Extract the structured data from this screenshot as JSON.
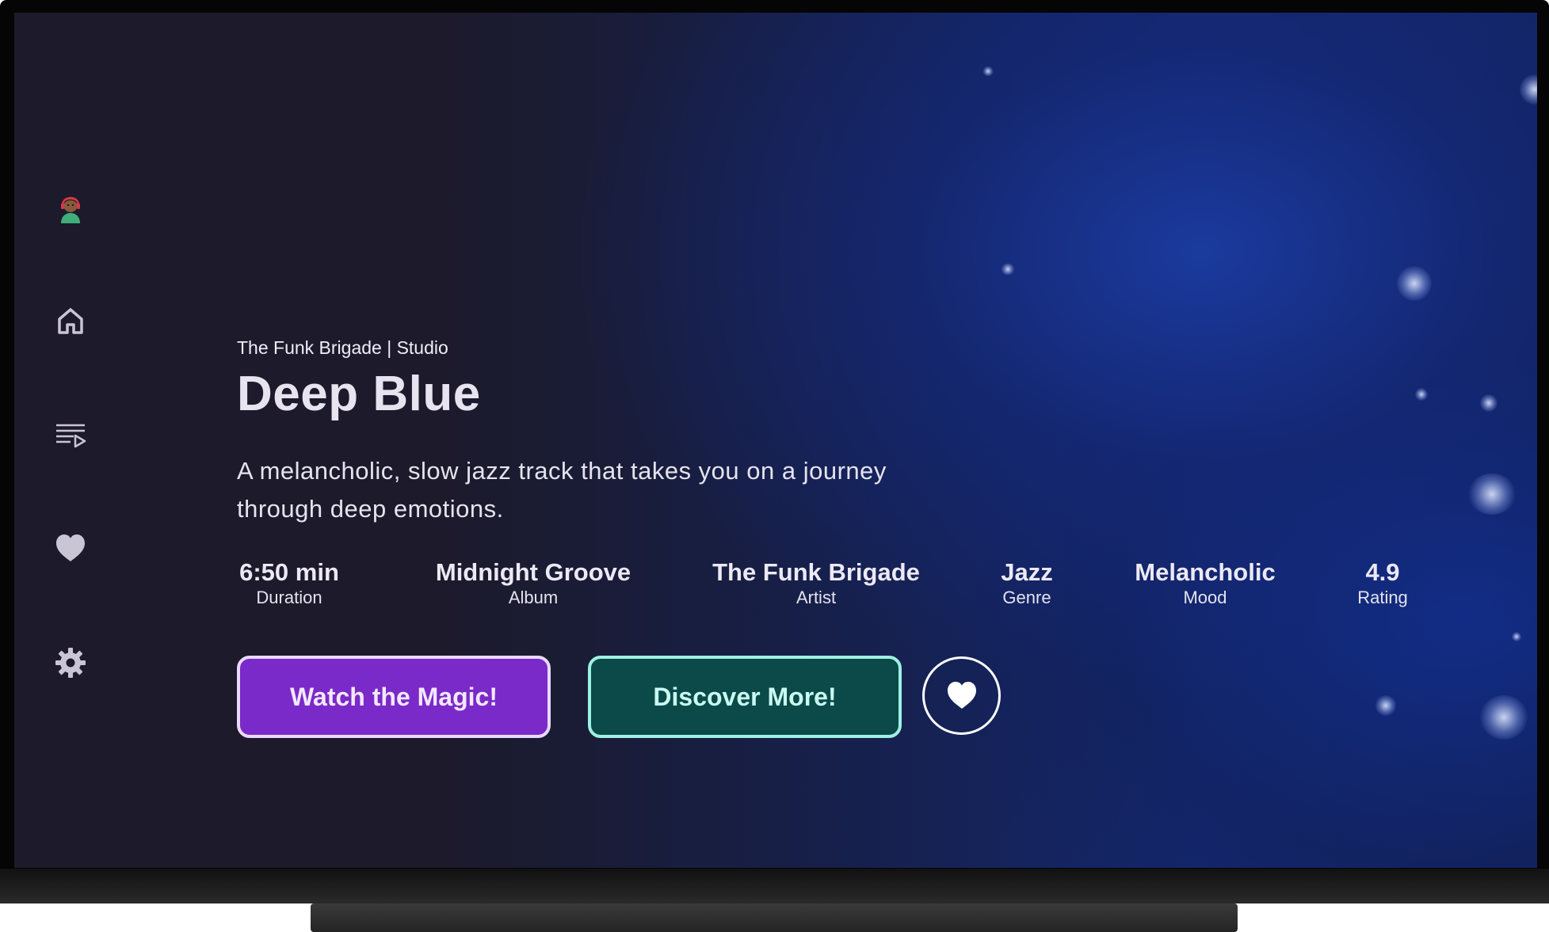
{
  "track": {
    "subtitle": "The Funk Brigade | Studio",
    "title": "Deep Blue",
    "description": "A melancholic, slow jazz track that takes you on a journey through deep emotions."
  },
  "stats": [
    {
      "value": "6:50 min",
      "label": "Duration"
    },
    {
      "value": "Midnight Groove",
      "label": "Album"
    },
    {
      "value": "The Funk Brigade",
      "label": "Artist"
    },
    {
      "value": "Jazz",
      "label": "Genre"
    },
    {
      "value": "Melancholic",
      "label": "Mood"
    },
    {
      "value": "4.9",
      "label": "Rating"
    }
  ],
  "buttons": {
    "primary_label": "Watch the Magic!",
    "secondary_label": "Discover More!"
  },
  "sidebar": {
    "items": [
      {
        "icon": "avatar-icon"
      },
      {
        "icon": "home-icon"
      },
      {
        "icon": "playlist-icon"
      },
      {
        "icon": "heart-icon"
      },
      {
        "icon": "gear-icon"
      }
    ]
  },
  "colors": {
    "background": "#1c1a2b",
    "primary_button": "#7a2ac8",
    "secondary_button": "#0b4a48",
    "secondary_border": "#9ef0e2",
    "icon": "#c9c5d4"
  }
}
